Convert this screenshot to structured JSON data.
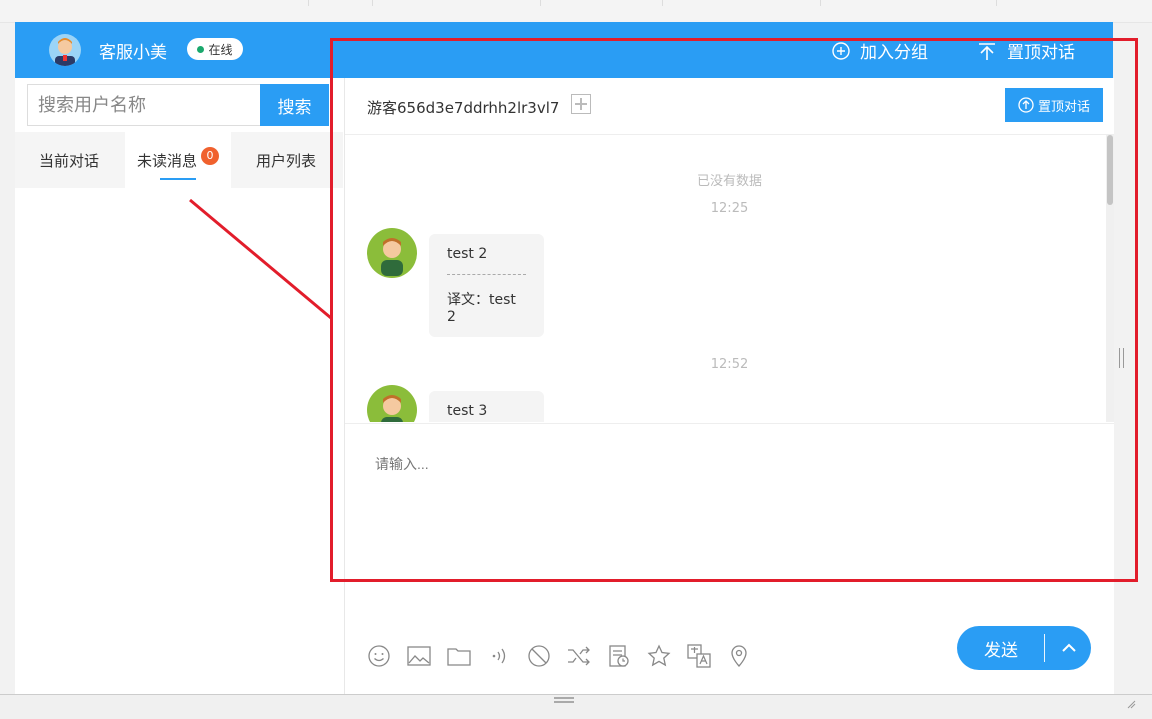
{
  "header": {
    "agent_name": "客服小美",
    "status": "在线",
    "join_group_label": "加入分组",
    "pin_label": "置顶对话",
    "brand_color": "#2a9df4"
  },
  "sidebar": {
    "search_placeholder": "搜索用户名称",
    "search_button": "搜索",
    "tabs": [
      {
        "label": "当前对话"
      },
      {
        "label": "未读消息",
        "badge": "0"
      },
      {
        "label": "用户列表"
      }
    ]
  },
  "conversation": {
    "visitor_name": "游客656d3e7ddrhh2lr3vl7",
    "pin_button": "置顶对话",
    "no_more_data": "已没有数据",
    "messages": [
      {
        "time": "12:25",
        "text": "test 2",
        "translation": "译文：test 2"
      },
      {
        "time": "12:52",
        "text": "test 3"
      }
    ],
    "input_placeholder": "请输入...",
    "send_label": "发送"
  },
  "toolbar_icons": [
    "emoji-icon",
    "image-icon",
    "folder-icon",
    "voice-icon",
    "block-icon",
    "transfer-icon",
    "history-icon",
    "star-icon",
    "translate-icon",
    "location-icon"
  ]
}
